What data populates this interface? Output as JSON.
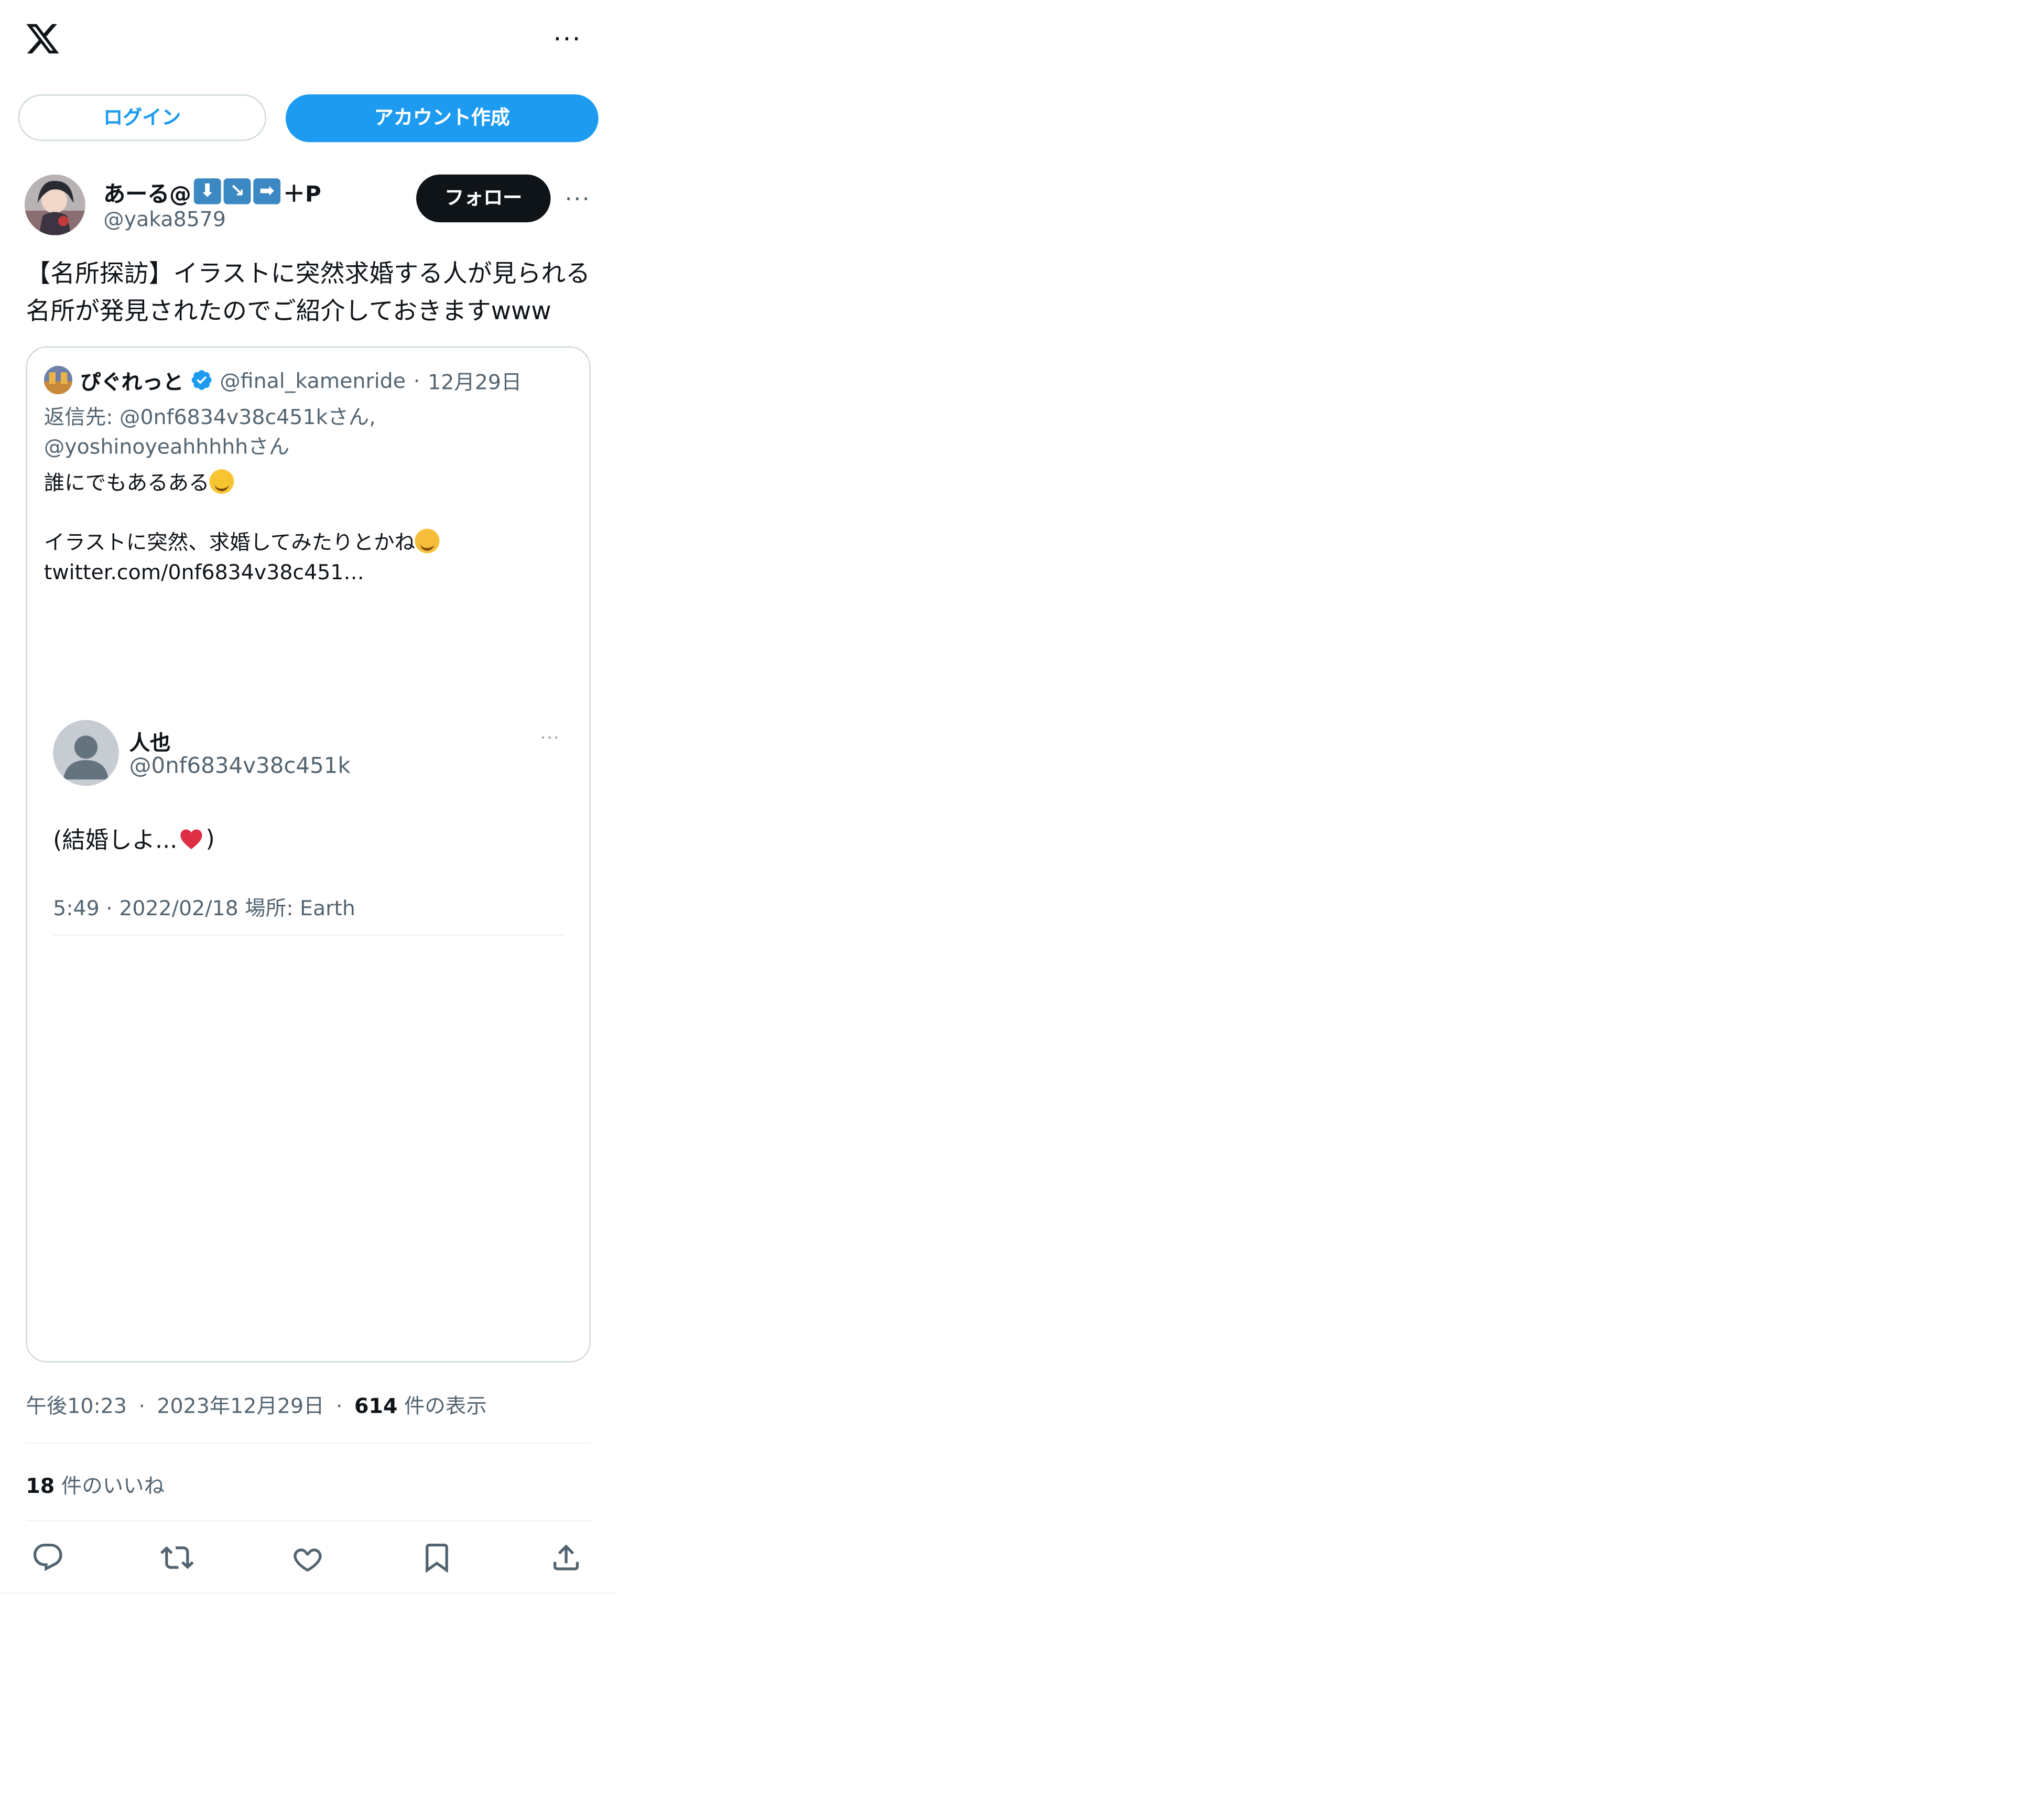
{
  "topbar": {
    "more_label": "···"
  },
  "auth": {
    "login_label": "ログイン",
    "signup_label": "アカウント作成"
  },
  "author": {
    "name_prefix": "あーる@",
    "name_suffix": "＋P",
    "emoji_keys": [
      "⬇",
      "↘",
      "➡"
    ],
    "handle": "@yaka8579",
    "follow_label": "フォロー",
    "more_label": "···"
  },
  "tweet": {
    "text": "【名所探訪】イラストに突然求婚する人が見られる名所が発見されたのでご紹介しておきますwww"
  },
  "quoted": {
    "name": "ぴぐれっと",
    "handle": "@final_kamenride",
    "separator": "·",
    "date": "12月29日",
    "reply_line1": "返信先: @0nf6834v38c451kさん,",
    "reply_line2": "@yoshinoyeahhhhhさん",
    "body_line1": "誰にでもあるある",
    "body_line2": "イラストに突然、求婚してみたりとかね",
    "body_line3": "twitter.com/0nf6834v38c451…"
  },
  "embedded": {
    "name": "人也",
    "handle": "@0nf6834v38c451k",
    "more_label": "···",
    "text_before": "(結婚しよ...",
    "text_after": ")",
    "meta": "5:49 · 2022/02/18 場所: Earth"
  },
  "meta": {
    "time": "午後10:23",
    "separator": "·",
    "date": "2023年12月29日",
    "views_count": "614",
    "views_label": "件の表示",
    "likes_count": "18",
    "likes_label": "件のいいね"
  },
  "colors": {
    "accent": "#1d9bf0",
    "text": "#0f1419",
    "muted": "#536471",
    "border": "#cfd9de"
  }
}
